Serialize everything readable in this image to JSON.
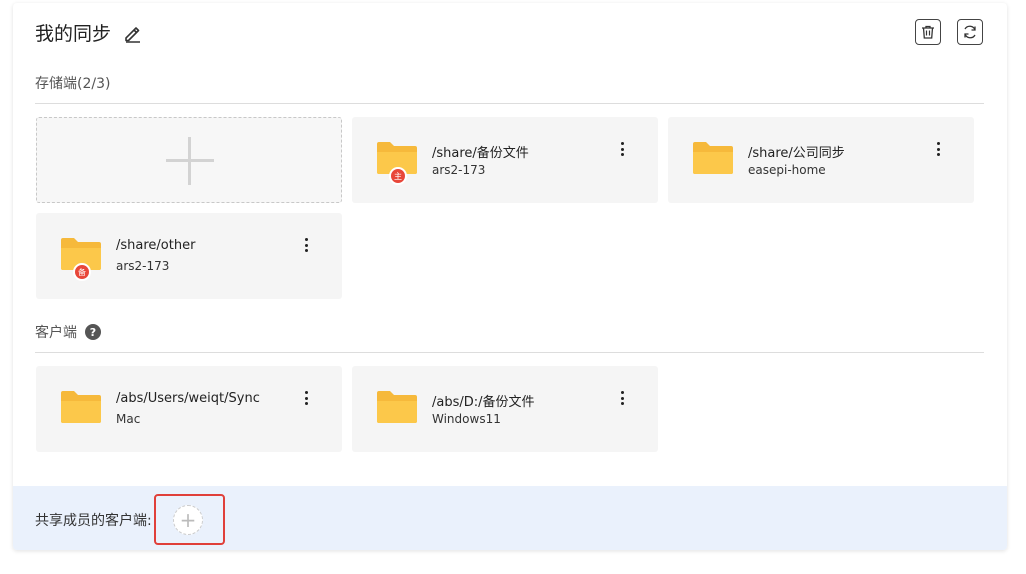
{
  "header": {
    "title": "我的同步",
    "edit_icon": "pencil-icon",
    "delete_icon": "trash-icon",
    "refresh_icon": "refresh-icon"
  },
  "storage": {
    "label": "存储端(2/3)",
    "add_icon": "plus-icon",
    "items": [
      {
        "path": "/share/备份文件",
        "device": "ars2-173",
        "badge": "主",
        "badge_color": "#e8473a"
      },
      {
        "path": "/share/公司同步",
        "device": "easepi-home",
        "badge": ""
      },
      {
        "path": "/share/other",
        "device": "ars2-173",
        "badge": "备",
        "badge_color": "#e8473a"
      }
    ]
  },
  "clients": {
    "label": "客户端",
    "help_icon": "question-icon",
    "help_glyph": "?",
    "items": [
      {
        "path": "/abs/Users/weiqt/Sync",
        "device": "Mac"
      },
      {
        "path": "/abs/D:/备份文件",
        "device": "Windows11"
      }
    ]
  },
  "shared": {
    "label": "共享成员的客户端:",
    "add_glyph": "+"
  },
  "colors": {
    "folder": "#fcc84a",
    "folder_back": "#f6b93b",
    "footer_bg": "#eaf1fc",
    "highlight": "#e0403a"
  }
}
